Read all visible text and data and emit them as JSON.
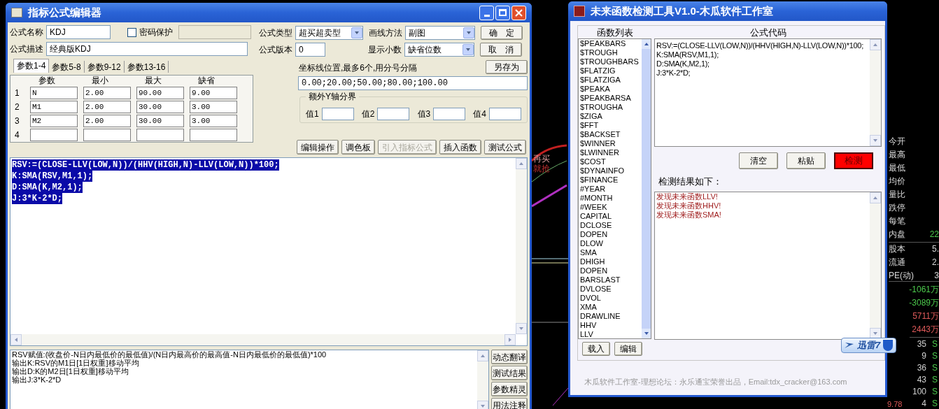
{
  "editor": {
    "title": "指标公式编辑器",
    "name": {
      "label": "公式名称",
      "value": "KDJ"
    },
    "password": {
      "label": "密码保护",
      "checked": false
    },
    "description": {
      "label": "公式描述",
      "value": "经典版KDJ"
    },
    "type": {
      "label": "公式类型",
      "value": "超买超卖型"
    },
    "version": {
      "label": "公式版本",
      "value": "0"
    },
    "draw_method": {
      "label": "画线方法",
      "value": "副图"
    },
    "decimals": {
      "label": "显示小数",
      "value": "缺省位数"
    },
    "side_buttons": [
      "确　定",
      "取　消",
      "另存为"
    ],
    "tabs": [
      {
        "label": "参数1-4",
        "selected": true
      },
      {
        "label": "参数5-8",
        "selected": false
      },
      {
        "label": "参数9-12",
        "selected": false
      },
      {
        "label": "参数13-16",
        "selected": false
      }
    ],
    "param_columns": [
      "参数",
      "最小",
      "最大",
      "缺省"
    ],
    "param_rows": [
      {
        "index": "1",
        "cells": [
          "N",
          "2.00",
          "90.00",
          "9.00"
        ]
      },
      {
        "index": "2",
        "cells": [
          "M1",
          "2.00",
          "30.00",
          "3.00"
        ]
      },
      {
        "index": "3",
        "cells": [
          "M2",
          "2.00",
          "30.00",
          "3.00"
        ]
      },
      {
        "index": "4"
      }
    ],
    "axis_label": "坐标线位置,最多6个,用分号分隔",
    "axis_value": "0.00;20.00;50.00;80.00;100.00",
    "y_group": {
      "title": "额外Y轴分界",
      "labels": [
        "值1",
        "值2",
        "值3",
        "值4"
      ]
    },
    "tool_buttons": [
      {
        "label": "编辑操作",
        "disabled": false
      },
      {
        "label": "调色板",
        "disabled": false
      },
      {
        "label": "引入指标公式",
        "disabled": true
      },
      {
        "label": "插入函数",
        "disabled": false
      },
      {
        "label": "测试公式",
        "disabled": false
      }
    ],
    "code_selected": true,
    "code_lines": [
      "RSV:=(CLOSE-LLV(LOW,N))/(HHV(HIGH,N)-LLV(LOW,N))*100;",
      "K:SMA(RSV,M1,1);",
      "D:SMA(K,M2,1);",
      "J:3*K-2*D;"
    ],
    "explanation_lines": [
      "RSV赋值:(收盘价-N日内最低价的最低值)/(N日内最高价的最高值-N日内最低价的最低值)*100",
      "输出K:RSV的M1日[1日权重]移动平均",
      "输出D:K的M2日[1日权重]移动平均",
      "输出J:3*K-2*D"
    ],
    "explain_buttons": [
      "动态翻译",
      "测试结果",
      "参数精灵",
      "用法注释"
    ]
  },
  "detector": {
    "title": "未来函数检测工具V1.0-木瓜软件工作室",
    "list_header": "函数列表",
    "functions": [
      "$PEAKBARS",
      "$TROUGH",
      "$TROUGHBARS",
      "$FLATZIG",
      "$FLATZIGA",
      "$PEAKA",
      "$PEAKBARSA",
      "$TROUGHA",
      "$ZIGA",
      "$FFT",
      "$BACKSET",
      "$WINNER",
      "$LWINNER",
      "$COST",
      "$DYNAINFO",
      "$FINANCE",
      "#YEAR",
      "#MONTH",
      "#WEEK",
      "CAPITAL",
      "DCLOSE",
      "DOPEN",
      "DLOW",
      "SMA",
      "DHIGH",
      "DOPEN",
      "BARSLAST",
      "DVLOSE",
      "DVOL",
      "XMA",
      "DRAWLINE",
      "HHV",
      "LLV"
    ],
    "list_buttons": [
      "载入",
      "编辑"
    ],
    "code_header": "公式代码",
    "code_lines": [
      "RSV:=(CLOSE-LLV(LOW,N))/(HHV(HIGH,N)-LLV(LOW,N))*100;",
      "K:SMA(RSV,M1,1);",
      "D:SMA(K,M2,1);",
      "J:3*K-2*D;"
    ],
    "buttons": [
      {
        "label": "清空",
        "kind": "normal"
      },
      {
        "label": "粘贴",
        "kind": "normal"
      },
      {
        "label": "检测",
        "kind": "alert"
      }
    ],
    "result_label": "检测结果如下：",
    "results": [
      "发现未来函数LLV!",
      "发现未来函数HHV!",
      "发现未来函数SMA!"
    ],
    "footer": "木瓜软件工作室-理想论坛：永乐通宝荣誉出品，Email:tdx_cracker@163.com"
  },
  "background": {
    "chart_notes": [
      "再买",
      "就抢"
    ],
    "quotes": [
      {
        "label": "今开"
      },
      {
        "label": "最高"
      },
      {
        "label": "最低"
      },
      {
        "label": "均价"
      },
      {
        "label": "量比"
      },
      {
        "label": "跌停"
      },
      {
        "label": "每笔"
      },
      {
        "label": "内盘",
        "value": "22"
      },
      {
        "label": "股本",
        "value": "5."
      },
      {
        "label": "流通",
        "value": "2."
      },
      {
        "label": "PE(动)",
        "value": "3"
      }
    ],
    "flows": [
      {
        "value": "-1061万",
        "color": "#4cc94c"
      },
      {
        "value": "-3089万",
        "color": "#4cc94c"
      },
      {
        "value": "5711万",
        "color": "#e05a5a"
      },
      {
        "value": "2443万",
        "color": "#e05a5a"
      }
    ],
    "ticks": [
      {
        "volume": "35",
        "side": "S"
      },
      {
        "volume": "9",
        "side": "S"
      },
      {
        "volume": "36",
        "side": "S"
      },
      {
        "volume": "43",
        "side": "S"
      },
      {
        "volume": "100",
        "side": "S"
      },
      {
        "volume": "4",
        "side": "S"
      }
    ],
    "price": "9.78"
  },
  "overlay_badge": "迅雷7"
}
